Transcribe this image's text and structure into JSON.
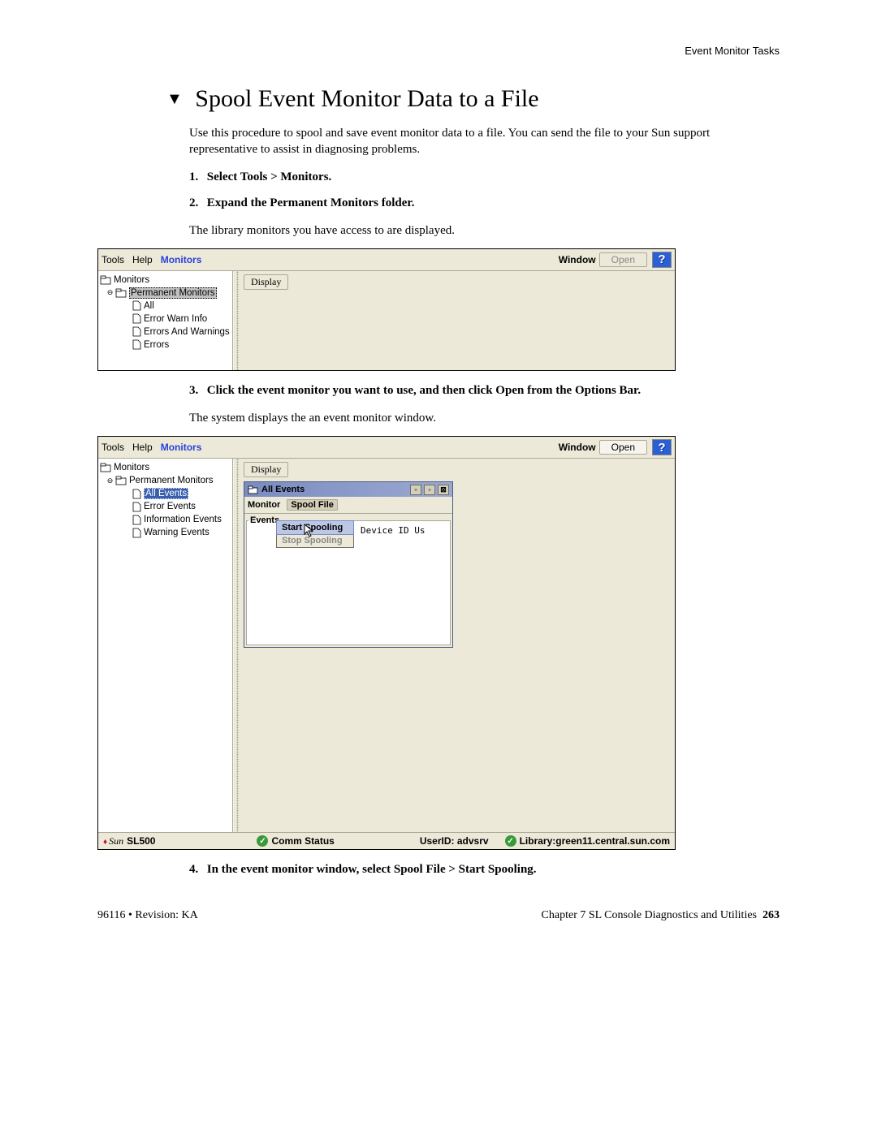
{
  "header": {
    "right_text": "Event Monitor Tasks"
  },
  "section": {
    "triangle": "▼",
    "title": "Spool Event Monitor Data to a File",
    "intro": "Use this procedure to spool and save event monitor data to a file. You can send the file to your Sun support representative to assist in diagnosing problems.",
    "steps": {
      "s1": "Select Tools > Monitors.",
      "s2": "Expand the Permanent Monitors folder.",
      "s2_body": "The library monitors you have access to are displayed.",
      "s3": "Click the event monitor you want to use, and then click Open from the Options Bar.",
      "s3_body": "The system displays the an event monitor window.",
      "s4": "In the event monitor window, select Spool File > Start Spooling."
    }
  },
  "shot1": {
    "menubar": {
      "tools": "Tools",
      "help": "Help",
      "monitors": "Monitors",
      "window": "Window",
      "open": "Open"
    },
    "tree": {
      "root": "Monitors",
      "permanent": "Permanent Monitors",
      "items": [
        "All",
        "Error Warn Info",
        "Errors And Warnings",
        "Errors"
      ]
    },
    "display_btn": "Display"
  },
  "shot2": {
    "menubar": {
      "tools": "Tools",
      "help": "Help",
      "monitors": "Monitors",
      "window": "Window",
      "open": "Open"
    },
    "tree": {
      "root": "Monitors",
      "permanent": "Permanent Monitors",
      "items": [
        "All Events",
        "Error Events",
        "Information Events",
        "Warning Events"
      ]
    },
    "display_btn": "Display",
    "inner": {
      "title": "All Events",
      "monitor": "Monitor",
      "spool_file": "Spool File",
      "events_group": "Events",
      "dropdown": {
        "start": "Start Spooling",
        "stop": "Stop Spooling"
      },
      "headers": "Device ID    Us"
    },
    "status": {
      "sun": "Sun",
      "product": "SL500",
      "comm": "Comm Status",
      "userid_label": "UserID:",
      "userid_value": "advsrv",
      "lib_label": "Library:",
      "lib_value": "green11.central.sun.com"
    }
  },
  "footer": {
    "left": "96116 • Revision: KA",
    "right_chapter": "Chapter 7 SL Console Diagnostics and Utilities",
    "right_page": "263"
  }
}
